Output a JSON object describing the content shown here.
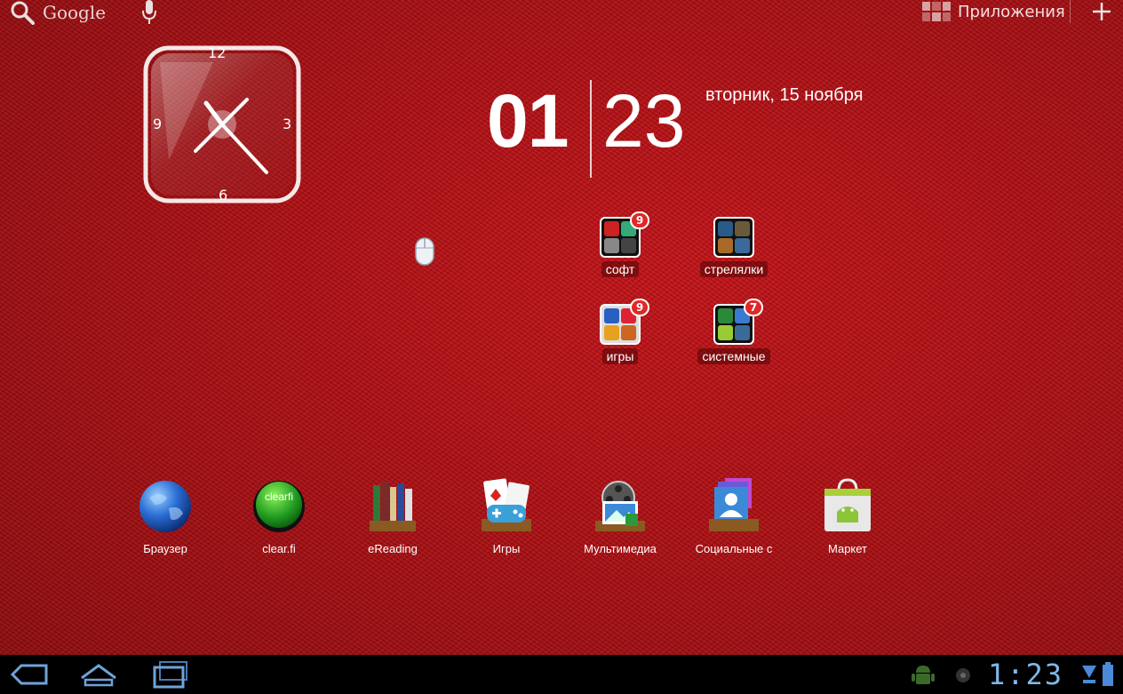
{
  "topbar": {
    "search_label": "Google",
    "apps_label": "Приложения"
  },
  "analog_clock": {
    "numerals": [
      "12",
      "3",
      "6",
      "9"
    ]
  },
  "digital_clock": {
    "hours": "01",
    "minutes": "23",
    "date": "вторник, 15 ноября"
  },
  "folders": [
    {
      "label": "софт",
      "badge": "9"
    },
    {
      "label": "стрелялки",
      "badge": ""
    },
    {
      "label": "игры",
      "badge": "9"
    },
    {
      "label": "системные",
      "badge": "7"
    }
  ],
  "dock": [
    {
      "label": "Браузер",
      "icon": "globe-icon"
    },
    {
      "label": "clear.fi",
      "icon": "clearfi-icon",
      "icon_text": "clearfi"
    },
    {
      "label": "eReading",
      "icon": "books-icon"
    },
    {
      "label": "Игры",
      "icon": "games-icon"
    },
    {
      "label": "Мультимедиа",
      "icon": "multimedia-icon"
    },
    {
      "label": "Социальные с",
      "icon": "social-icon"
    },
    {
      "label": "Маркет",
      "icon": "market-icon"
    }
  ],
  "system_bar": {
    "time": "1:23"
  },
  "colors": {
    "wallpaper": "#b01014",
    "badge": "#e12727",
    "system_time": "#7fb7ea"
  }
}
